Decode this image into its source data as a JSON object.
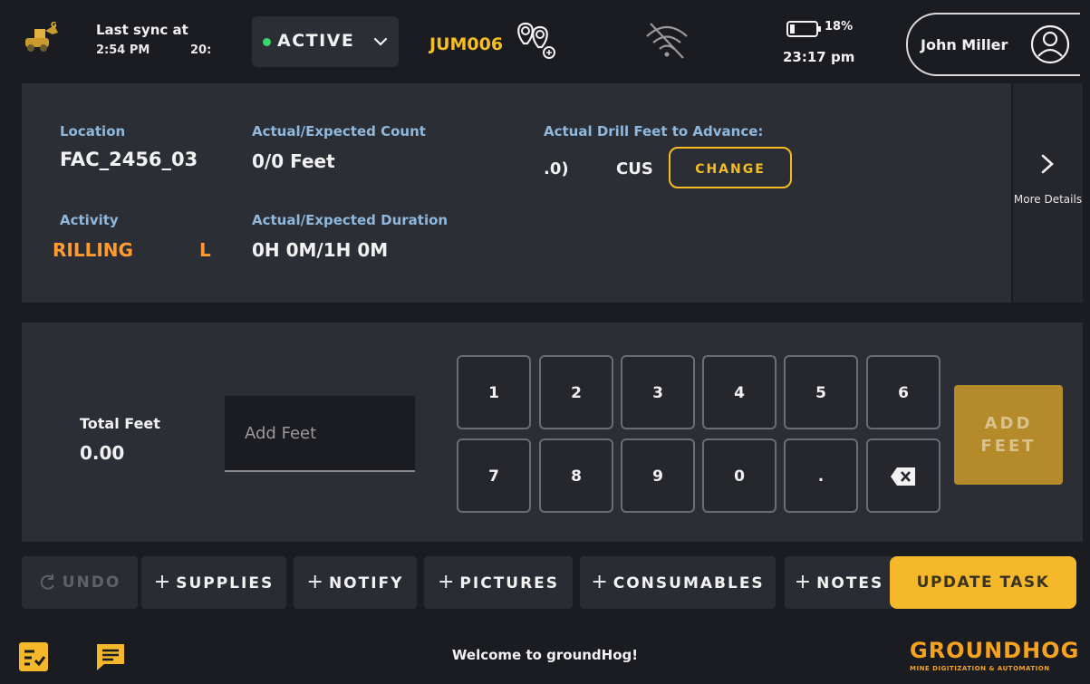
{
  "header": {
    "sync_label": "Last sync at",
    "sync_time": "2:54 PM",
    "sync_extra": "20:",
    "status": "ACTIVE",
    "equipment_id": "JUM006",
    "battery_pct": "18%",
    "battery_level": 0.18,
    "clock": "23:17 pm",
    "user_name": "John Miller"
  },
  "info": {
    "location_label": "Location",
    "location_value": "FAC_2456_03",
    "count_label": "Actual/Expected Count",
    "count_value": "0/0 Feet",
    "drill_label": "Actual Drill Feet to Advance:",
    "drill_value_a": ".0)",
    "drill_value_b": "CUS",
    "change_label": "CHANGE",
    "activity_label": "Activity",
    "activity_value": "RILLING",
    "activity_suffix": "L",
    "duration_label": "Actual/Expected Duration",
    "duration_value": "0H 0M/1H 0M",
    "more_label": "More Details"
  },
  "keypad": {
    "total_label": "Total Feet",
    "total_value": "0.00",
    "input_placeholder": "Add Feet",
    "keys_row1": [
      "1",
      "2",
      "3",
      "4",
      "5",
      "6"
    ],
    "keys_row2": [
      "7",
      "8",
      "9",
      "0",
      "."
    ],
    "add_line1": "ADD",
    "add_line2": "FEET"
  },
  "actions": {
    "undo": "UNDO",
    "supplies": "SUPPLIES",
    "notify": "NOTIFY",
    "pictures": "PICTURES",
    "consumables": "CONSUMABLES",
    "notes": "NOTES",
    "update": "UPDATE TASK"
  },
  "footer": {
    "welcome": "Welcome to groundHog!",
    "brand": "GROUNDHOG",
    "tagline": "MINE DIGITIZATION & AUTOMATION"
  },
  "colors": {
    "accent": "#f4b82a",
    "label_orange": "#ff8f2e",
    "active_green": "#38d66b",
    "panel": "#2c2e36"
  }
}
